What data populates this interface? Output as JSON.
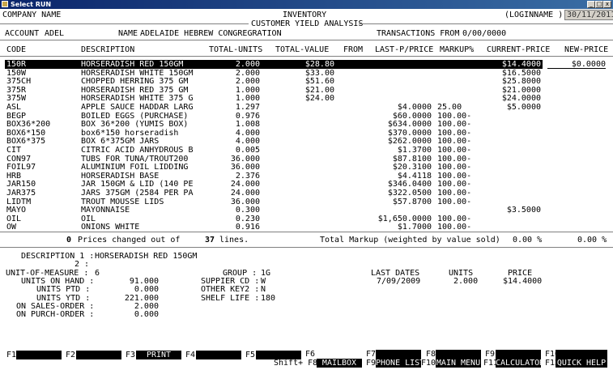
{
  "window": {
    "title": "Select RUN",
    "buttons": [
      "_",
      "□",
      "x"
    ]
  },
  "header": {
    "company": "COMPANY NAME",
    "title1": "INVENTORY",
    "title2": "CUSTOMER YIELD ANALYSIS",
    "login_open": "(LOGINNAME )",
    "date": "30/11/2011"
  },
  "account": {
    "label": "ACCOUNT",
    "code": "ADEL",
    "name_label": "NAME",
    "name": "ADELAIDE HEBREW CONGREGRATION",
    "transactions_label": "TRANSACTIONS FROM",
    "transactions_from": "0/00/0000"
  },
  "columns": [
    "CODE",
    "DESCRIPTION",
    "TOTAL-UNITS",
    "TOTAL-VALUE",
    "FROM",
    "LAST-P/PRICE",
    "MARKUP%",
    "CURRENT-PRICE",
    "NEW-PRICE"
  ],
  "rows": [
    {
      "code": "150R",
      "desc": "HORSERADISH RED 150GM",
      "units": "2.000",
      "value": "$28.80",
      "from": "",
      "last": "",
      "markup": "",
      "current": "$14.4000",
      "new": "$0.0000"
    },
    {
      "code": "150W",
      "desc": "HORSERADISH WHITE 150GM",
      "units": "2.000",
      "value": "$33.00",
      "from": "",
      "last": "",
      "markup": "",
      "current": "$16.5000",
      "new": ""
    },
    {
      "code": "375CH",
      "desc": "CHOPPED HERRING 375 GM",
      "units": "2.000",
      "value": "$51.60",
      "from": "",
      "last": "",
      "markup": "",
      "current": "$25.8000",
      "new": ""
    },
    {
      "code": "375R",
      "desc": "HORSERADISH RED 375 GM",
      "units": "1.000",
      "value": "$21.00",
      "from": "",
      "last": "",
      "markup": "",
      "current": "$21.0000",
      "new": ""
    },
    {
      "code": "375W",
      "desc": "HORSERADISH WHITE 375 G",
      "units": "1.000",
      "value": "$24.00",
      "from": "",
      "last": "",
      "markup": "",
      "current": "$24.0000",
      "new": ""
    },
    {
      "code": "ASL",
      "desc": "APPLE SAUCE HADDAR LARG",
      "units": "1.297",
      "value": "",
      "from": "",
      "last": "$4.0000",
      "markup": "25.00",
      "current": "$5.0000",
      "new": ""
    },
    {
      "code": "BEGP",
      "desc": "BOILED EGGS (PURCHASE)",
      "units": "0.976",
      "value": "",
      "from": "",
      "last": "$60.0000",
      "markup": "100.00-",
      "current": "",
      "new": ""
    },
    {
      "code": "BOX36*200",
      "desc": "BOX 36*200 (YUMIS BOX)",
      "units": "1.008",
      "value": "",
      "from": "",
      "last": "$634.0000",
      "markup": "100.00-",
      "current": "",
      "new": ""
    },
    {
      "code": "BOX6*150",
      "desc": "box6*150 horseradish",
      "units": "4.000",
      "value": "",
      "from": "",
      "last": "$370.0000",
      "markup": "100.00-",
      "current": "",
      "new": ""
    },
    {
      "code": "BOX6*375",
      "desc": "BOX 6*375GM JARS",
      "units": "4.000",
      "value": "",
      "from": "",
      "last": "$262.0000",
      "markup": "100.00-",
      "current": "",
      "new": ""
    },
    {
      "code": "CIT",
      "desc": "CITRIC ACID ANHYDROUS B",
      "units": "0.005",
      "value": "",
      "from": "",
      "last": "$1.3700",
      "markup": "100.00-",
      "current": "",
      "new": ""
    },
    {
      "code": "CON97",
      "desc": "TUBS FOR TUNA/TROUT200",
      "units": "36.000",
      "value": "",
      "from": "",
      "last": "$87.8100",
      "markup": "100.00-",
      "current": "",
      "new": ""
    },
    {
      "code": "FOIL97",
      "desc": "ALUMINIUM FOIL LIDDING",
      "units": "36.000",
      "value": "",
      "from": "",
      "last": "$20.3100",
      "markup": "100.00-",
      "current": "",
      "new": ""
    },
    {
      "code": "HRB",
      "desc": "HORSERADISH BASE",
      "units": "2.376",
      "value": "",
      "from": "",
      "last": "$4.4118",
      "markup": "100.00-",
      "current": "",
      "new": ""
    },
    {
      "code": "JAR150",
      "desc": "JAR 150GM & LID (140 PE",
      "units": "24.000",
      "value": "",
      "from": "",
      "last": "$346.0400",
      "markup": "100.00-",
      "current": "",
      "new": ""
    },
    {
      "code": "JAR375",
      "desc": "JARS 375GM (2584 PER PA",
      "units": "24.000",
      "value": "",
      "from": "",
      "last": "$322.0500",
      "markup": "100.00-",
      "current": "",
      "new": ""
    },
    {
      "code": "LIDTM",
      "desc": "TROUT MOUSSE LIDS",
      "units": "36.000",
      "value": "",
      "from": "",
      "last": "$57.8700",
      "markup": "100.00-",
      "current": "",
      "new": ""
    },
    {
      "code": "MAYO",
      "desc": "MAYONNAISE",
      "units": "0.300",
      "value": "",
      "from": "",
      "last": "",
      "markup": "",
      "current": "$3.5000",
      "new": ""
    },
    {
      "code": "OIL",
      "desc": "OIL",
      "units": "0.230",
      "value": "",
      "from": "",
      "last": "$1,650.0000",
      "markup": "100.00-",
      "current": "",
      "new": ""
    },
    {
      "code": "OW",
      "desc": "ONIONS WHITE",
      "units": "0.916",
      "value": "",
      "from": "",
      "last": "$1.7000",
      "markup": "100.00-",
      "current": "",
      "new": ""
    }
  ],
  "summary": {
    "changed_count": "0",
    "changed_text": "Prices changed out of",
    "lines_count": "37",
    "lines_text": "lines.",
    "markup_label": "Total Markup (weighted by value sold)",
    "markup_value": "0.00 %",
    "markup_value2": "0.00 %"
  },
  "detail": {
    "desc1_label": "DESCRIPTION 1 :",
    "desc1": "HORSERADISH RED 150GM",
    "desc2_label": "2 :",
    "uom_label": "UNIT-OF-MEASURE :",
    "uom": "6",
    "onhand_label": "UNITS ON HAND :",
    "onhand": "91.000",
    "ptd_label": "UNITS PTD :",
    "ptd": "0.000",
    "ytd_label": "UNITS YTD :",
    "ytd": "221.000",
    "sales_label": "ON SALES-ORDER :",
    "sales": "2.000",
    "purch_label": "ON PURCH-ORDER :",
    "purch": "0.000",
    "group_label": "GROUP :",
    "group": "1G",
    "supp_label": "SUPPIER CD :",
    "supp": "W",
    "key2_label": "OTHER KEY2 :",
    "key2": "N",
    "shelf_label": "SHELF LIFE :",
    "shelf": "180",
    "lastdates_label": "LAST DATES",
    "lastdate": "7/09/2009",
    "units_label": "UNITS",
    "units": "2.000",
    "price_label": "PRICE",
    "price": "$14.4000"
  },
  "fkeys": {
    "f1": "F1",
    "f2": "F2",
    "f3": "F3",
    "f3_label": "PRINT",
    "f4": "F4",
    "f5": "F5",
    "f6": "F6",
    "shift": "Shift+ F8",
    "f8_label": "MAILBOX",
    "f7": "F7",
    "f9": "F9",
    "f9_label": "PHONE LIST",
    "f8": "F8",
    "f10": "F10",
    "f10_label": "MAIN MENU",
    "f11": "F11",
    "f11_label": "CALCULATOR",
    "f10b": "F10",
    "f12": "F12",
    "f12_label": "QUICK HELP"
  }
}
